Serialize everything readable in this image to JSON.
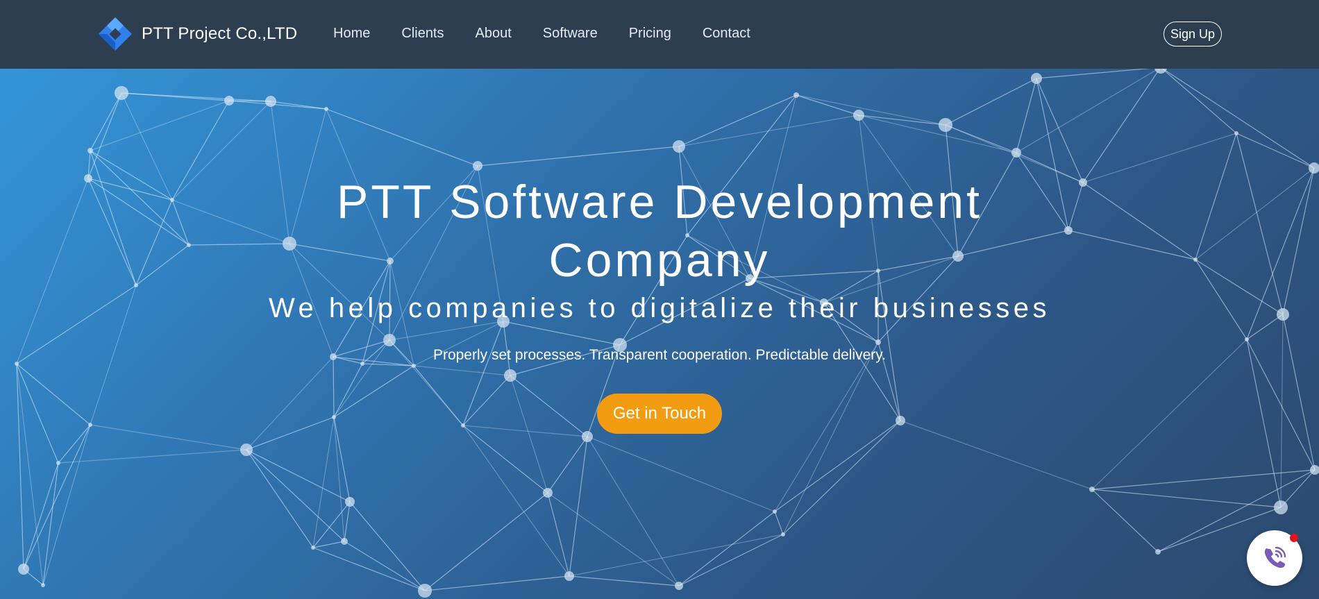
{
  "header": {
    "brand_name": "PTT Project Co.,LTD",
    "logo_icon": "diamond-logo-icon",
    "nav": [
      {
        "label": "Home"
      },
      {
        "label": "Clients"
      },
      {
        "label": "About"
      },
      {
        "label": "Software"
      },
      {
        "label": "Pricing"
      },
      {
        "label": "Contact"
      }
    ],
    "signup_label": "Sign Up"
  },
  "hero": {
    "title": "PTT Software Development Company",
    "subtitle": "We help companies to digitalize their businesses",
    "tagline": "Properly set processes. Transparent cooperation. Predictable delivery.",
    "cta_label": "Get in Touch",
    "background_icon": "network-mesh-graphic"
  },
  "floating": {
    "call_icon": "phone-call-icon",
    "notification_badge": "red-dot"
  },
  "colors": {
    "header_bg": "#2d3e50",
    "hero_gradient_start": "#3495d9",
    "hero_gradient_end": "#2c4a6f",
    "cta_bg": "#f39c12",
    "logo_blue": "#2f80ed",
    "call_icon": "#7b5bb5",
    "badge_red": "#e0141b"
  }
}
